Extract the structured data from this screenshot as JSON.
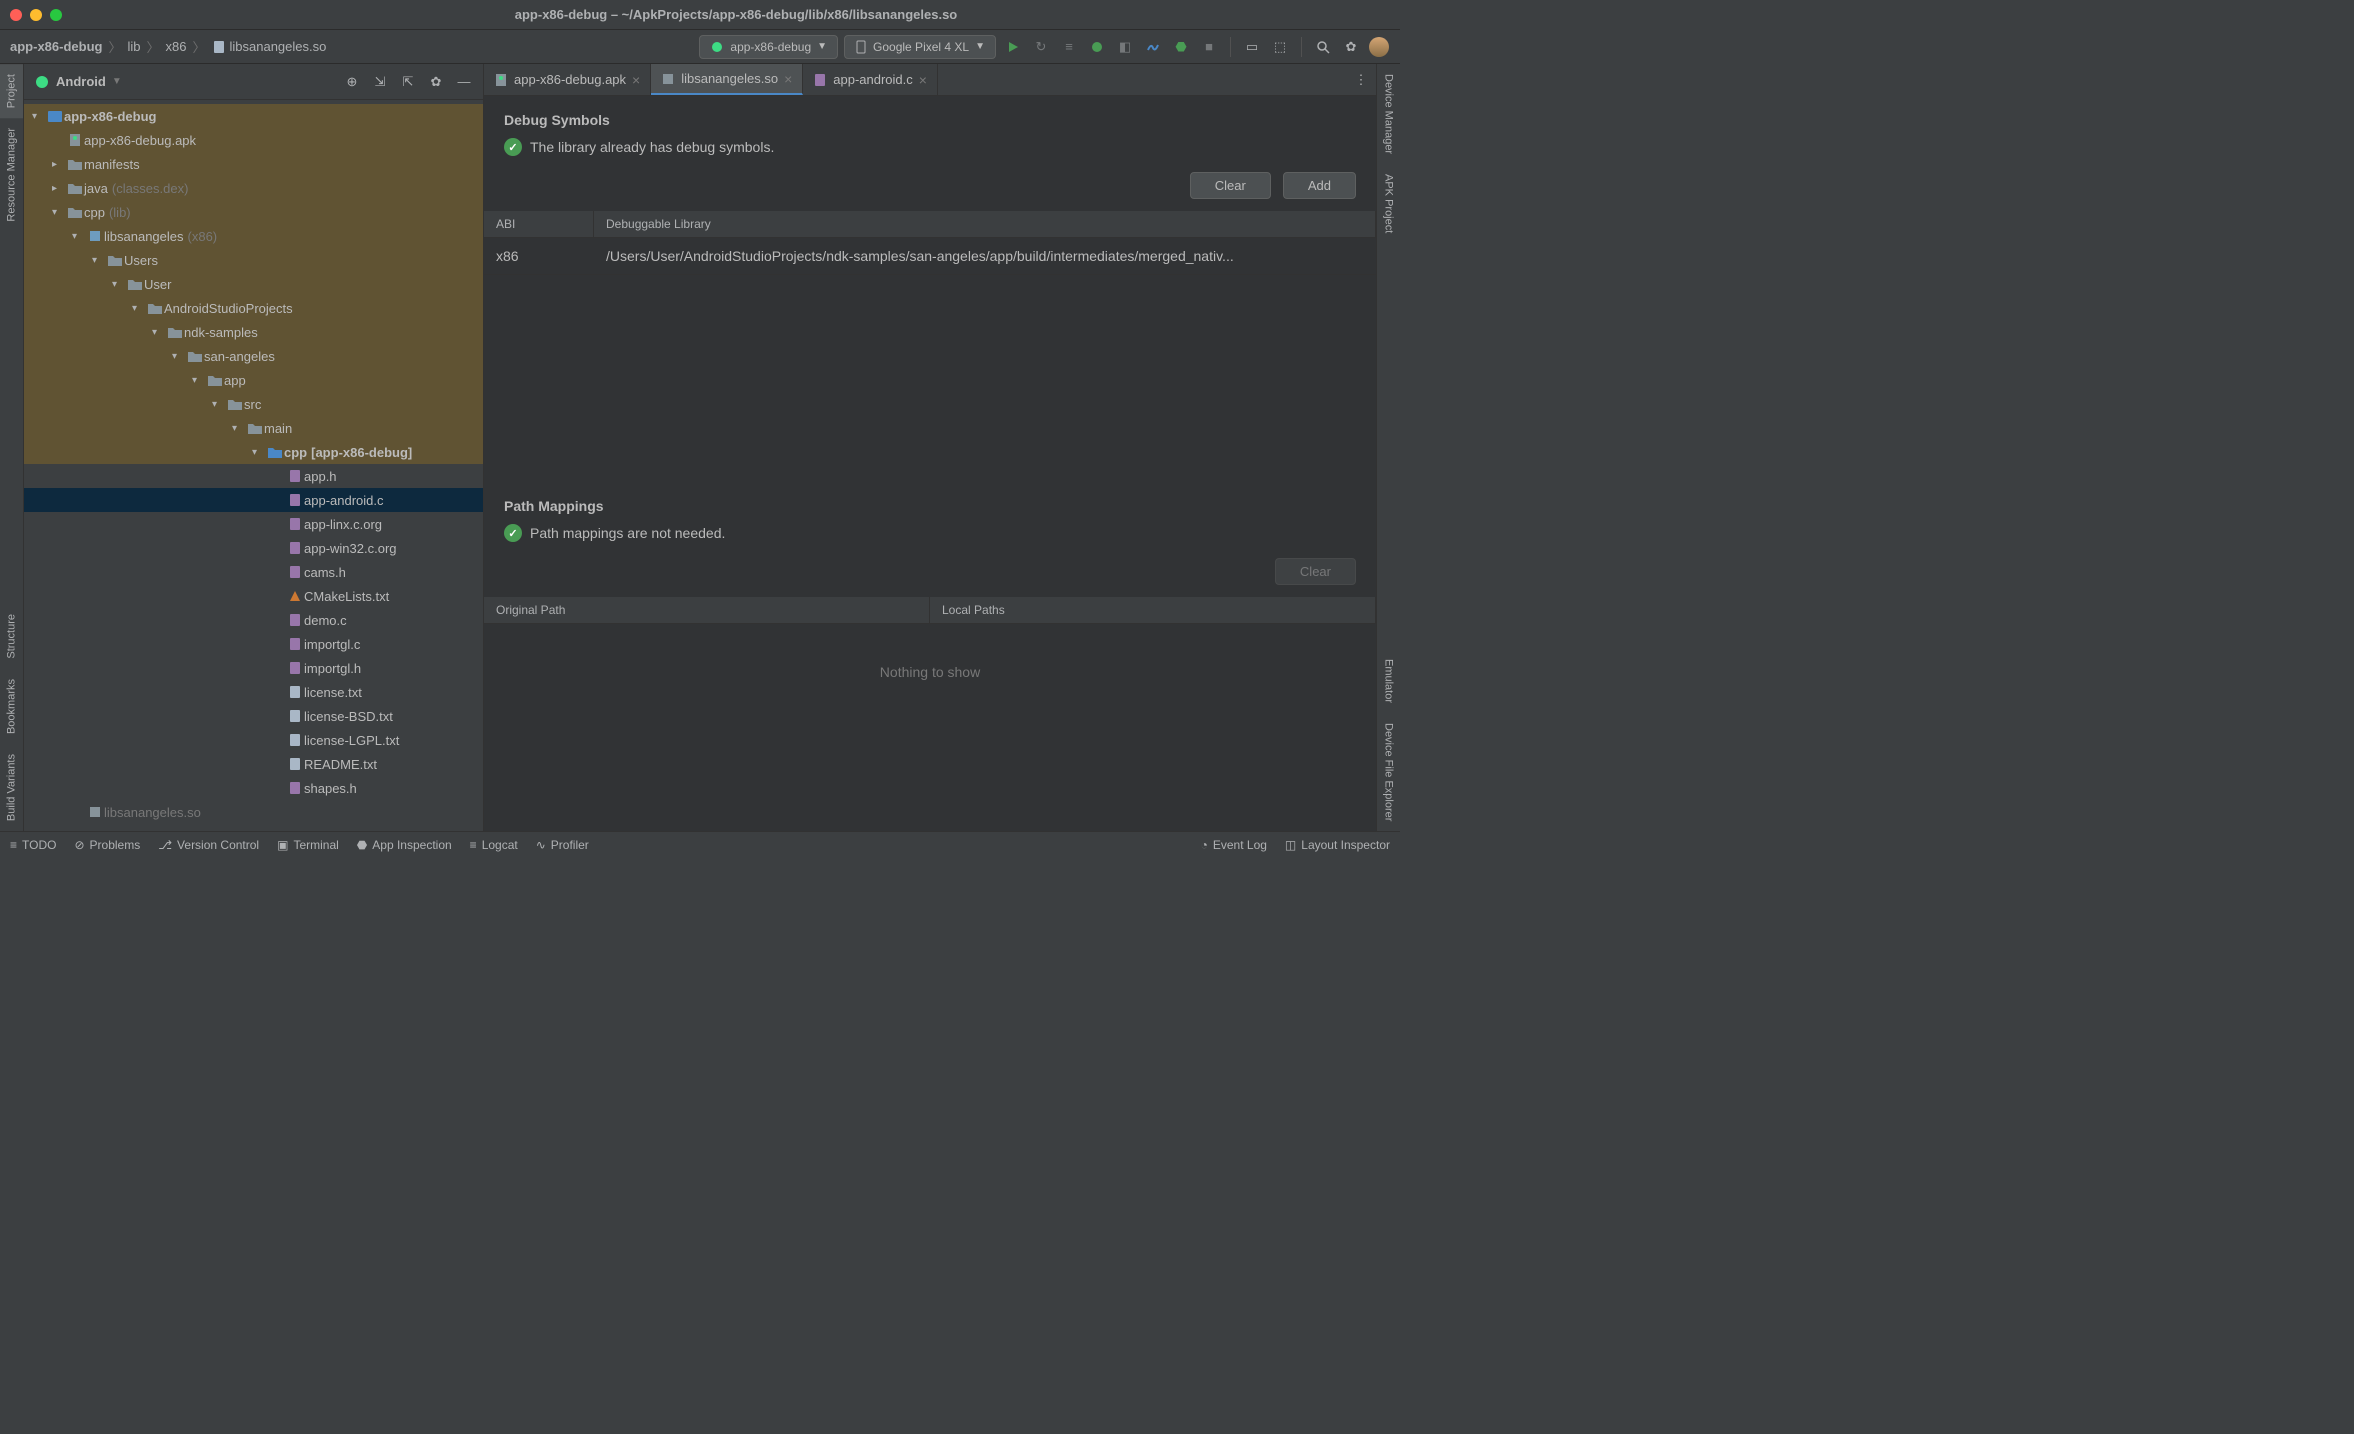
{
  "titlebar": {
    "title": "app-x86-debug – ~/ApkProjects/app-x86-debug/lib/x86/libsanangeles.so"
  },
  "breadcrumb": {
    "items": [
      "app-x86-debug",
      "lib",
      "x86",
      "libsanangeles.so"
    ]
  },
  "toolbar": {
    "run_config": "app-x86-debug",
    "device": "Google Pixel 4 XL"
  },
  "left_strip": {
    "items": [
      "Project",
      "Resource Manager",
      "Structure",
      "Bookmarks",
      "Build Variants"
    ]
  },
  "right_strip": {
    "items": [
      "Device Manager",
      "APK Project",
      "Emulator",
      "Device File Explorer"
    ]
  },
  "project": {
    "header": "Android",
    "tree": [
      {
        "depth": 0,
        "expand": "v",
        "label": "app-x86-debug",
        "bold": true,
        "hl": true,
        "icon": "module"
      },
      {
        "depth": 1,
        "expand": "",
        "label": "app-x86-debug.apk",
        "hl": true,
        "icon": "apk"
      },
      {
        "depth": 1,
        "expand": ">",
        "label": "manifests",
        "hl": true,
        "icon": "folder"
      },
      {
        "depth": 1,
        "expand": ">",
        "label": "java",
        "paren": "(classes.dex)",
        "hl": true,
        "icon": "folder"
      },
      {
        "depth": 1,
        "expand": "v",
        "label": "cpp",
        "paren": "(lib)",
        "hl": true,
        "icon": "folder"
      },
      {
        "depth": 2,
        "expand": "v",
        "label": "libsanangeles",
        "paren": "(x86)",
        "hl": true,
        "icon": "lib"
      },
      {
        "depth": 3,
        "expand": "v",
        "label": "Users",
        "hl": true,
        "icon": "folder"
      },
      {
        "depth": 4,
        "expand": "v",
        "label": "User",
        "hl": true,
        "icon": "folder"
      },
      {
        "depth": 5,
        "expand": "v",
        "label": "AndroidStudioProjects",
        "hl": true,
        "icon": "folder"
      },
      {
        "depth": 6,
        "expand": "v",
        "label": "ndk-samples",
        "hl": true,
        "icon": "folder"
      },
      {
        "depth": 7,
        "expand": "v",
        "label": "san-angeles",
        "hl": true,
        "icon": "folder"
      },
      {
        "depth": 8,
        "expand": "v",
        "label": "app",
        "hl": true,
        "icon": "folder"
      },
      {
        "depth": 9,
        "expand": "v",
        "label": "src",
        "hl": true,
        "icon": "folder"
      },
      {
        "depth": 10,
        "expand": "v",
        "label": "main",
        "hl": true,
        "icon": "folder"
      },
      {
        "depth": 11,
        "expand": "v",
        "label": "cpp",
        "bold": true,
        "suffix": "[app-x86-debug]",
        "hl": true,
        "icon": "src"
      },
      {
        "depth": 12,
        "expand": "",
        "label": "app.h",
        "icon": "h"
      },
      {
        "depth": 12,
        "expand": "",
        "label": "app-android.c",
        "selected": true,
        "icon": "c"
      },
      {
        "depth": 12,
        "expand": "",
        "label": "app-linx.c.org",
        "icon": "c"
      },
      {
        "depth": 12,
        "expand": "",
        "label": "app-win32.c.org",
        "icon": "c"
      },
      {
        "depth": 12,
        "expand": "",
        "label": "cams.h",
        "icon": "h"
      },
      {
        "depth": 12,
        "expand": "",
        "label": "CMakeLists.txt",
        "icon": "cmake"
      },
      {
        "depth": 12,
        "expand": "",
        "label": "demo.c",
        "icon": "c"
      },
      {
        "depth": 12,
        "expand": "",
        "label": "importgl.c",
        "icon": "c"
      },
      {
        "depth": 12,
        "expand": "",
        "label": "importgl.h",
        "icon": "h"
      },
      {
        "depth": 12,
        "expand": "",
        "label": "license.txt",
        "icon": "txt"
      },
      {
        "depth": 12,
        "expand": "",
        "label": "license-BSD.txt",
        "icon": "txt"
      },
      {
        "depth": 12,
        "expand": "",
        "label": "license-LGPL.txt",
        "icon": "txt"
      },
      {
        "depth": 12,
        "expand": "",
        "label": "README.txt",
        "icon": "txt"
      },
      {
        "depth": 12,
        "expand": "",
        "label": "shapes.h",
        "icon": "h"
      },
      {
        "depth": 2,
        "expand": "",
        "label": "libsanangeles.so",
        "dim": true,
        "icon": "so"
      }
    ]
  },
  "tabs": [
    {
      "label": "app-x86-debug.apk",
      "icon": "apk",
      "active": false
    },
    {
      "label": "libsanangeles.so",
      "icon": "so",
      "active": true
    },
    {
      "label": "app-android.c",
      "icon": "c",
      "active": false
    }
  ],
  "debug_symbols": {
    "title": "Debug Symbols",
    "status": "The library already has debug symbols.",
    "buttons": {
      "clear": "Clear",
      "add": "Add"
    },
    "headers": {
      "abi": "ABI",
      "lib": "Debuggable Library"
    },
    "row": {
      "abi": "x86",
      "path": "/Users/User/AndroidStudioProjects/ndk-samples/san-angeles/app/build/intermediates/merged_nativ..."
    }
  },
  "path_mappings": {
    "title": "Path Mappings",
    "status": "Path mappings are not needed.",
    "buttons": {
      "clear": "Clear"
    },
    "headers": {
      "orig": "Original Path",
      "local": "Local Paths"
    },
    "empty": "Nothing to show"
  },
  "bottom": {
    "items": [
      "TODO",
      "Problems",
      "Version Control",
      "Terminal",
      "App Inspection",
      "Logcat",
      "Profiler"
    ],
    "right": [
      "Event Log",
      "Layout Inspector"
    ]
  }
}
